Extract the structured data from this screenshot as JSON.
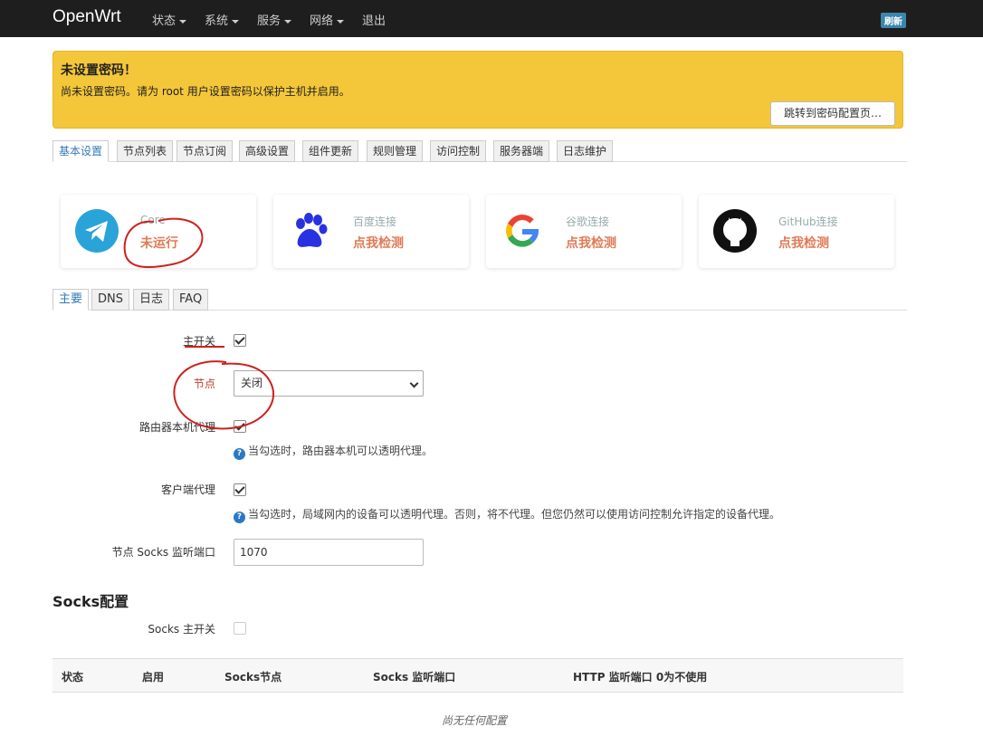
{
  "navbar": {
    "brand": "OpenWrt",
    "menu": [
      {
        "label": "状态",
        "caret": true
      },
      {
        "label": "系统",
        "caret": true
      },
      {
        "label": "服务",
        "caret": true
      },
      {
        "label": "网络",
        "caret": true
      },
      {
        "label": "退出",
        "caret": false
      }
    ],
    "refresh_label": "刷新"
  },
  "alert": {
    "title": "未设置密码！",
    "message": "尚未设置密码。请为 root 用户设置密码以保护主机并启用。",
    "button": "跳转到密码配置页…"
  },
  "main_tabs": [
    "基本设置",
    "节点列表",
    "节点订阅",
    "高级设置",
    "组件更新",
    "规则管理",
    "访问控制",
    "服务器端",
    "日志维护"
  ],
  "main_tabs_active": 0,
  "status_cards": [
    {
      "title": "Core",
      "status": "未运行",
      "icon": "telegram-icon"
    },
    {
      "title": "百度连接",
      "status": "点我检测",
      "icon": "baidu-paw-icon"
    },
    {
      "title": "谷歌连接",
      "status": "点我检测",
      "icon": "google-icon"
    },
    {
      "title": "GitHub连接",
      "status": "点我检测",
      "icon": "github-icon"
    }
  ],
  "sub_tabs": [
    "主要",
    "DNS",
    "日志",
    "FAQ"
  ],
  "sub_tabs_active": 0,
  "form": {
    "main_switch_label": "主开关",
    "main_switch_checked": true,
    "node_label": "节点",
    "node_value": "关闭",
    "router_proxy_label": "路由器本机代理",
    "router_proxy_checked": true,
    "router_proxy_help": "当勾选时，路由器本机可以透明代理。",
    "client_proxy_label": "客户端代理",
    "client_proxy_checked": true,
    "client_proxy_help": "当勾选时，局域网内的设备可以透明代理。否则，将不代理。但您仍然可以使用访问控制允许指定的设备代理。",
    "socks_port_label": "节点 Socks 监听端口",
    "socks_port_value": "1070",
    "help_glyph": "?"
  },
  "socks": {
    "title": "Socks配置",
    "switch_label": "Socks 主开关",
    "switch_checked": false,
    "columns": [
      "状态",
      "启用",
      "Socks节点",
      "Socks 监听端口",
      "HTTP 监听端口 0为不使用"
    ],
    "empty_text": "尚无任何配置"
  },
  "colors": {
    "navbar_bg": "#1e1e1e",
    "alert_bg": "#f4c639",
    "accent": "#337ab7",
    "status_text": "#e07a55",
    "annotation": "#d0201e"
  }
}
